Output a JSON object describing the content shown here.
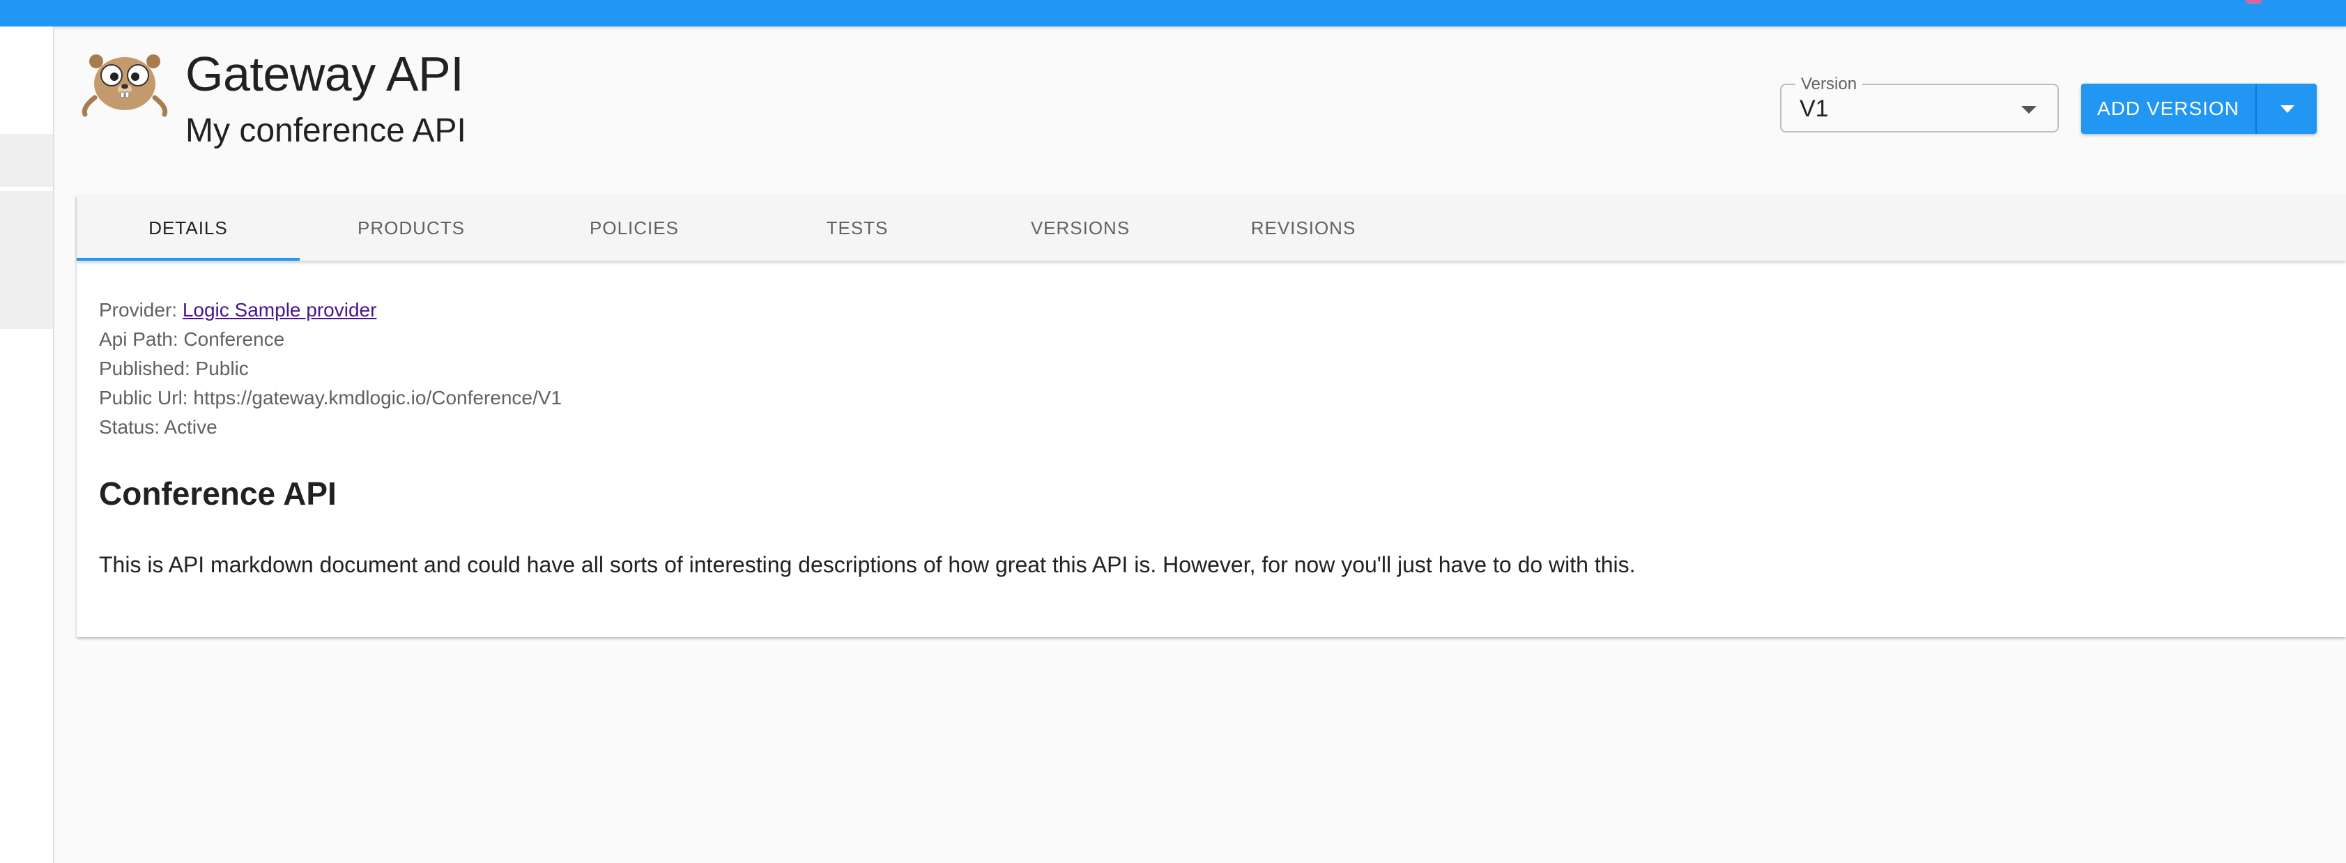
{
  "header": {
    "title": "Gateway API",
    "subtitle": "My conference API",
    "logo_icon": "gopher-mascot-icon"
  },
  "version_select": {
    "label": "Version",
    "value": "V1"
  },
  "add_version_button": {
    "label": "ADD VERSION"
  },
  "tabs": [
    {
      "label": "DETAILS",
      "active": true
    },
    {
      "label": "PRODUCTS",
      "active": false
    },
    {
      "label": "POLICIES",
      "active": false
    },
    {
      "label": "TESTS",
      "active": false
    },
    {
      "label": "VERSIONS",
      "active": false
    },
    {
      "label": "REVISIONS",
      "active": false
    }
  ],
  "details": {
    "provider_label": "Provider: ",
    "provider_link": "Logic Sample provider",
    "api_path": "Api Path: Conference",
    "published": "Published: Public",
    "public_url": "Public Url: https://gateway.kmdlogic.io/Conference/V1",
    "status": "Status: Active"
  },
  "document": {
    "heading": "Conference API",
    "body": "This is API markdown document and could have all sorts of interesting descriptions of how great this API is. However, for now you'll just have to do with this."
  },
  "colors": {
    "primary": "#2196f3",
    "link": "#4a148c"
  }
}
